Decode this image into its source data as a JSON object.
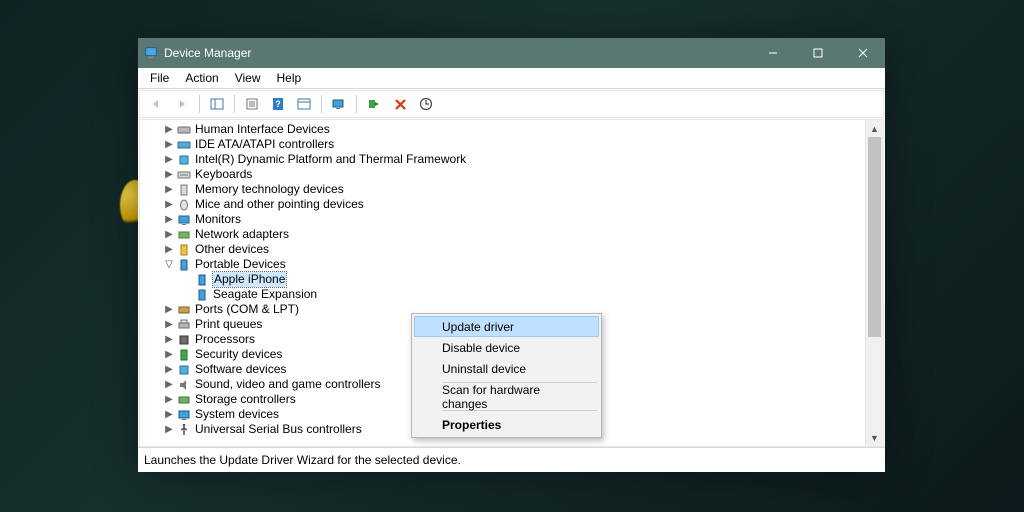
{
  "window": {
    "title": "Device Manager"
  },
  "menu": {
    "file": "File",
    "action": "Action",
    "view": "View",
    "help": "Help"
  },
  "tree": {
    "hid": "Human Interface Devices",
    "ide": "IDE ATA/ATAPI controllers",
    "dptf": "Intel(R) Dynamic Platform and Thermal Framework",
    "kbd": "Keyboards",
    "memtech": "Memory technology devices",
    "mice": "Mice and other pointing devices",
    "monitors": "Monitors",
    "netad": "Network adapters",
    "otherdev": "Other devices",
    "portable": "Portable Devices",
    "iphone": "Apple iPhone",
    "seagate": "Seagate Expansion",
    "ports": "Ports (COM & LPT)",
    "printq": "Print queues",
    "procs": "Processors",
    "secdev": "Security devices",
    "softdev": "Software devices",
    "sound": "Sound, video and game controllers",
    "storage": "Storage controllers",
    "sysdev": "System devices",
    "usb": "Universal Serial Bus controllers"
  },
  "context": {
    "update": "Update driver",
    "disable": "Disable device",
    "uninstall": "Uninstall device",
    "scan": "Scan for hardware changes",
    "props": "Properties"
  },
  "status": "Launches the Update Driver Wizard for the selected device."
}
